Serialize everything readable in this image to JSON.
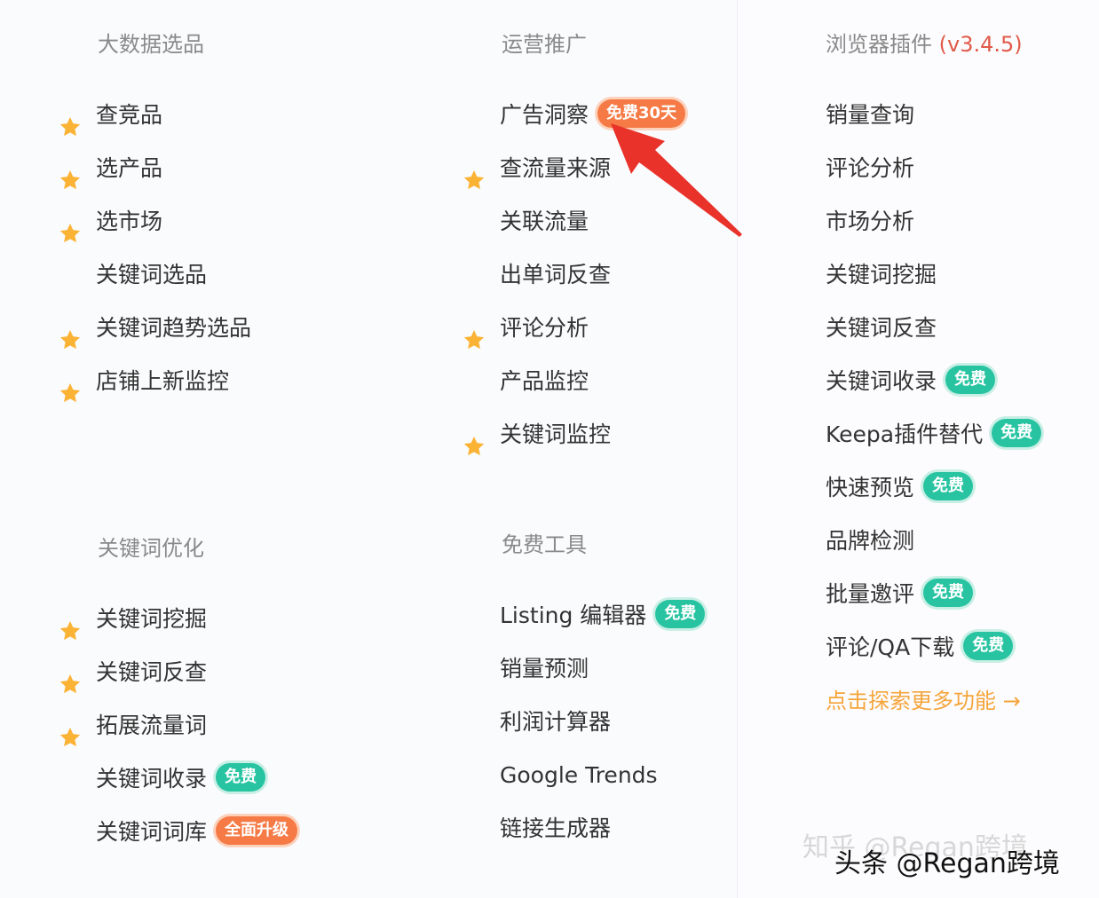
{
  "colors": {
    "star": "#fbb336",
    "badge_green": "#28c4a2",
    "badge_orange": "#f57a45",
    "arrow": "#e8322a",
    "more_link": "#f5a53a",
    "version": "#e05a4a"
  },
  "big_data": {
    "title": "大数据选品",
    "items": [
      {
        "label": "查竞品",
        "star": true
      },
      {
        "label": "选产品",
        "star": true
      },
      {
        "label": "选市场",
        "star": true
      },
      {
        "label": "关键词选品",
        "star": false
      },
      {
        "label": "关键词趋势选品",
        "star": true
      },
      {
        "label": "店铺上新监控",
        "star": true
      }
    ]
  },
  "operations": {
    "title": "运营推广",
    "items": [
      {
        "label": "广告洞察",
        "star": false,
        "badge": "免费30天",
        "badge_color": "orange"
      },
      {
        "label": "查流量来源",
        "star": true
      },
      {
        "label": "关联流量",
        "star": false
      },
      {
        "label": "出单词反查",
        "star": false
      },
      {
        "label": "评论分析",
        "star": true
      },
      {
        "label": "产品监控",
        "star": false
      },
      {
        "label": "关键词监控",
        "star": true
      }
    ]
  },
  "keyword_opt": {
    "title": "关键词优化",
    "items": [
      {
        "label": "关键词挖掘",
        "star": true
      },
      {
        "label": "关键词反查",
        "star": true
      },
      {
        "label": "拓展流量词",
        "star": true
      },
      {
        "label": "关键词收录",
        "star": false,
        "badge": "免费",
        "badge_color": "green"
      },
      {
        "label": "关键词词库",
        "star": false,
        "badge": "全面升级",
        "badge_color": "orange"
      }
    ]
  },
  "free_tools": {
    "title": "免费工具",
    "items": [
      {
        "label": "Listing 编辑器",
        "star": false,
        "badge": "免费",
        "badge_color": "green"
      },
      {
        "label": "销量预测",
        "star": false
      },
      {
        "label": "利润计算器",
        "star": false
      },
      {
        "label": "Google Trends",
        "star": false
      },
      {
        "label": "链接生成器",
        "star": false
      }
    ]
  },
  "browser_plugin": {
    "title": "浏览器插件",
    "version": "(v3.4.5)",
    "items": [
      {
        "label": "销量查询"
      },
      {
        "label": "评论分析"
      },
      {
        "label": "市场分析"
      },
      {
        "label": "关键词挖掘"
      },
      {
        "label": "关键词反查"
      },
      {
        "label": "关键词收录",
        "badge": "免费",
        "badge_color": "green"
      },
      {
        "label": "Keepa插件替代",
        "badge": "免费",
        "badge_color": "green"
      },
      {
        "label": "快速预览",
        "badge": "免费",
        "badge_color": "green"
      },
      {
        "label": "品牌检测"
      },
      {
        "label": "批量邀评",
        "badge": "免费",
        "badge_color": "green"
      },
      {
        "label": "评论/QA下载",
        "badge": "免费",
        "badge_color": "green"
      }
    ],
    "more_link": "点击探索更多功能 →"
  },
  "watermarks": {
    "zhihu": "知乎 @Regan跨境",
    "toutiao": "头条 @Regan跨境"
  }
}
